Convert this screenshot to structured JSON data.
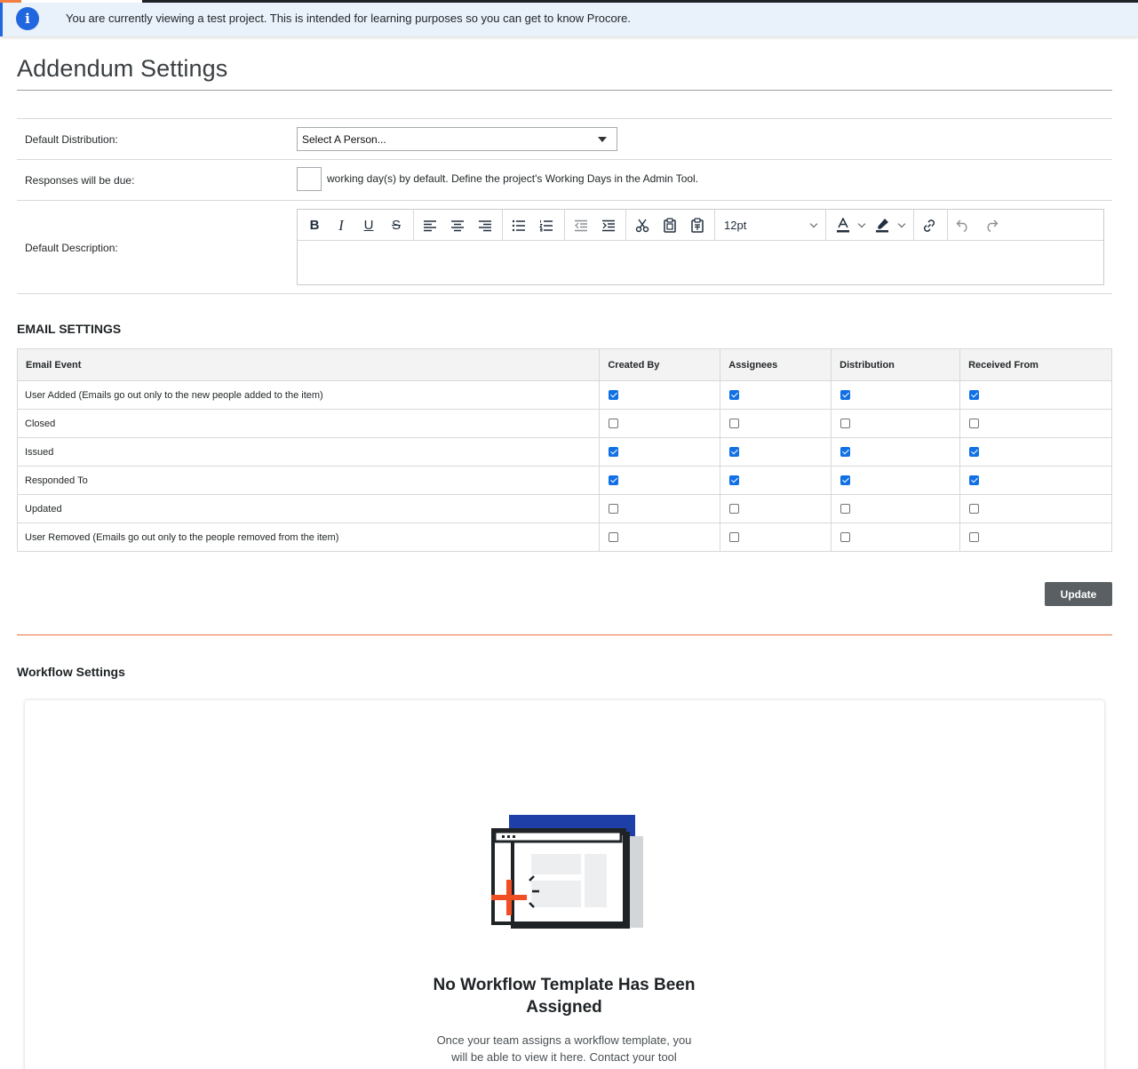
{
  "banner": {
    "text": "You are currently viewing a test project. This is intended for learning purposes so you can get to know Procore."
  },
  "page": {
    "title": "Addendum Settings"
  },
  "form": {
    "distribution_label": "Default Distribution:",
    "distribution_value": "Select A Person...",
    "due_label": "Responses will be due:",
    "due_value": "",
    "due_suffix": "working day(s) by default. Define the project's Working Days in the Admin Tool.",
    "description_label": "Default Description:",
    "font_size": "12pt"
  },
  "email": {
    "title": "EMAIL SETTINGS",
    "columns": [
      "Email Event",
      "Created By",
      "Assignees",
      "Distribution",
      "Received From"
    ],
    "rows": [
      {
        "event": "User Added (Emails go out only to the new people added to the item)",
        "checks": [
          true,
          true,
          true,
          true
        ]
      },
      {
        "event": "Closed",
        "checks": [
          false,
          false,
          false,
          false
        ]
      },
      {
        "event": "Issued",
        "checks": [
          true,
          true,
          true,
          true
        ]
      },
      {
        "event": "Responded To",
        "checks": [
          true,
          true,
          true,
          true
        ]
      },
      {
        "event": "Updated",
        "checks": [
          false,
          false,
          false,
          false
        ]
      },
      {
        "event": "User Removed (Emails go out only to the people removed from the item)",
        "checks": [
          false,
          false,
          false,
          false
        ]
      }
    ],
    "update_label": "Update"
  },
  "workflow": {
    "title": "Workflow Settings",
    "heading": "No Workflow Template Has Been Assigned",
    "body": "Once your team assigns a workflow template, you will be able to view it here. Contact your tool"
  },
  "colors": {
    "accent": "#f47e42",
    "info_blue": "#2066df",
    "checkbox_blue": "#1170e4",
    "illustration_blue": "#1f3fa8",
    "illustration_red": "#f04e23"
  }
}
